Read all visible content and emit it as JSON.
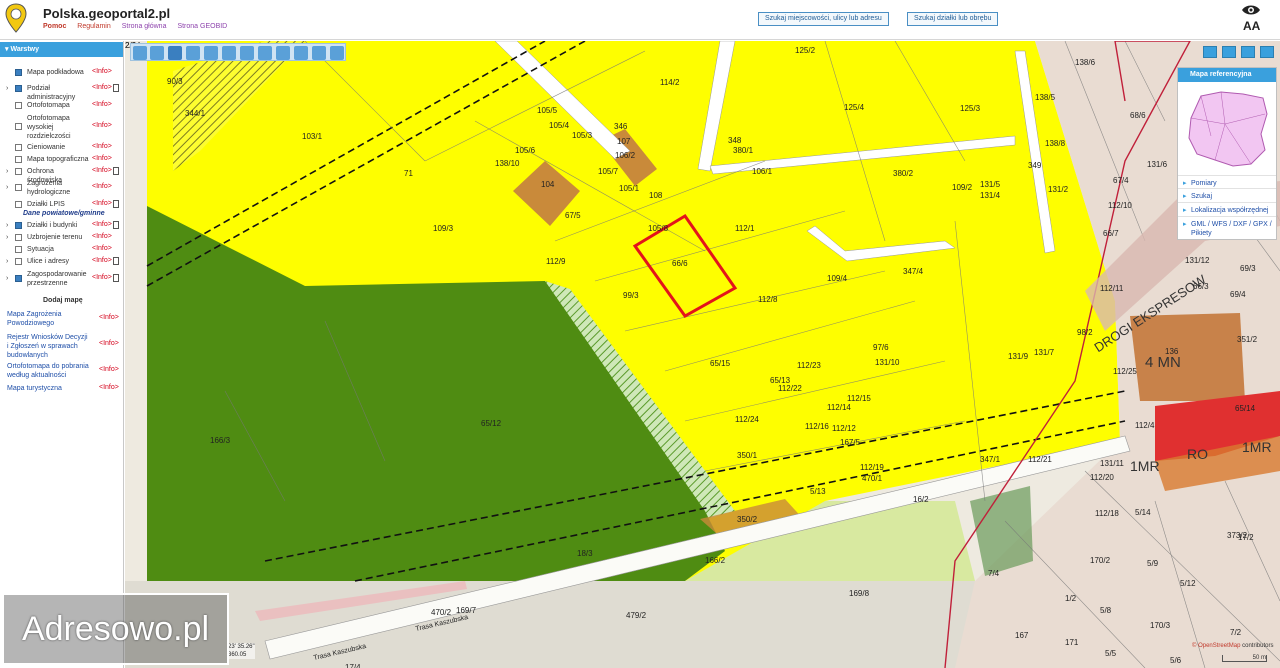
{
  "header": {
    "title": "Polska.geoportal2.pl",
    "links": [
      "Pomoc",
      "Regulamin",
      "Strona główna",
      "Strona GEOBID"
    ],
    "search_place_button": "Szukaj miejscowości, ulicy lub adresu",
    "search_parcel_button": "Szukaj działki lub obrębu",
    "font_size_label": "AA"
  },
  "layers_panel": {
    "title": "Warstwy",
    "info_label": "<Info>",
    "layers": [
      {
        "label": "Mapa podkładowa",
        "checked": true
      },
      {
        "label": "Podział administracyjny",
        "checked": true
      },
      {
        "label": "Ortofotomapa",
        "checked": false
      },
      {
        "label": "Ortofotomapa wysokiej rozdzielczości",
        "checked": false
      },
      {
        "label": "Cieniowanie",
        "checked": false
      },
      {
        "label": "Mapa topograficzna",
        "checked": false
      },
      {
        "label": "Ochrona środowiska",
        "checked": false
      },
      {
        "label": "Zagrożenia hydrologiczne",
        "checked": false
      },
      {
        "label": "Działki LPIS",
        "checked": false
      },
      {
        "label": "Działki i budynki",
        "checked": true
      },
      {
        "label": "Uzbrojenie terenu",
        "checked": false
      },
      {
        "label": "Sytuacja",
        "checked": false
      },
      {
        "label": "Ulice i adresy",
        "checked": false
      },
      {
        "label": "Zagospodarowanie przestrzenne",
        "checked": true
      }
    ],
    "section_head": "Dane powiatowe/gminne",
    "add_map_title": "Dodaj mapę",
    "add_maps": [
      "Mapa Zagrożenia Powodziowego",
      "Rejestr Wniosków Decyzji i Zgłoszeń w sprawach budowlanych",
      "Ortofotomapa do pobrania według aktualności",
      "Mapa turystyczna"
    ]
  },
  "reference_panel": {
    "title": "Mapa referencyjna",
    "items": [
      "Pomiary",
      "Szukaj",
      "Lokalizacja współrzędnej",
      "GML / WFS / DXF / GPX / Pikiety"
    ]
  },
  "map": {
    "coordinates": [
      "23' 35.26\"",
      "360.05"
    ],
    "scale": "50 m",
    "attribution_brand": "© OpenStreetMap",
    "attribution_rest": " contributors",
    "watermark": "Adresowo.pl",
    "road_labels": [
      "Trasa Kaszubska",
      "Trasa Kaszubska"
    ],
    "zone_labels": [
      "4 MN",
      "1MR",
      "RO",
      "1MR",
      "DROGI EKSPRESOW"
    ],
    "parcels": [
      "125/2",
      "138/6",
      "90/3",
      "114/2",
      "344/1",
      "105/5",
      "125/4",
      "125/3",
      "138/5",
      "103/1",
      "105/4",
      "105/3",
      "348",
      "380/1",
      "68/6",
      "105/6",
      "346",
      "107",
      "106/2",
      "138/8",
      "138/10",
      "105/7",
      "106/1",
      "380/2",
      "349",
      "131/6",
      "71",
      "104",
      "105/1",
      "108",
      "109/2",
      "131/5",
      "131/4",
      "131/2",
      "67/4",
      "67/5",
      "109/3",
      "105/8",
      "112/1",
      "112/10",
      "66/7",
      "66/6",
      "112/9",
      "109/4",
      "347/4",
      "131/12",
      "69/3",
      "99/3",
      "112/8",
      "112/11",
      "66/3",
      "69/4",
      "98/2",
      "351/2",
      "97/6",
      "131/10",
      "131/9",
      "131/7",
      "136",
      "65/15",
      "112/23",
      "112/25",
      "65/13",
      "112/22",
      "112/15",
      "112/14",
      "112/24",
      "112/16",
      "112/12",
      "112/4",
      "65/14",
      "65/12",
      "166/3",
      "167/5",
      "112/21",
      "350/1",
      "112/19",
      "347/1",
      "131/11",
      "470/1",
      "112/20",
      "5/13",
      "16/2",
      "112/18",
      "350/2",
      "5/14",
      "373/2",
      "17/2",
      "18/3",
      "166/2",
      "170/2",
      "5/9",
      "7/4",
      "5/12",
      "470/2",
      "169/7",
      "169/8",
      "1/2",
      "5/8",
      "479/2",
      "170/3",
      "7/2",
      "17/4",
      "167",
      "171",
      "5/5",
      "5/6",
      "2/24",
      "2/3"
    ]
  },
  "colors": {
    "accent": "#3aa0dd",
    "zone_yellow": "#fefe00",
    "zone_green": "#4f8c12",
    "parcel_highlight": "#e3141b"
  }
}
